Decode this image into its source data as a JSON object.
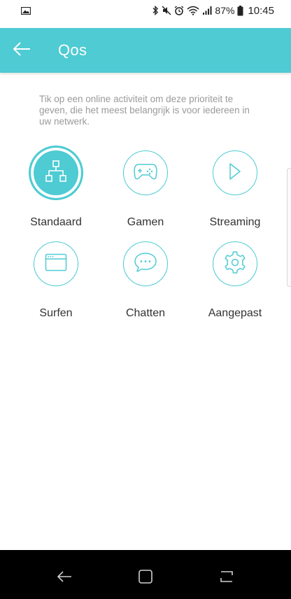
{
  "status_bar": {
    "battery": "87%",
    "time": "10:45"
  },
  "app_bar": {
    "title": "Qos"
  },
  "description": "Tik op een online activiteit om deze prioriteit te geven, die het meest belangrijk is voor iedereen in uw netwerk.",
  "modes": [
    {
      "label": "Standaard",
      "icon": "network-icon",
      "selected": true
    },
    {
      "label": "Gamen",
      "icon": "gamepad-icon",
      "selected": false
    },
    {
      "label": "Streaming",
      "icon": "play-icon",
      "selected": false
    },
    {
      "label": "Surfen",
      "icon": "browser-icon",
      "selected": false
    },
    {
      "label": "Chatten",
      "icon": "chat-icon",
      "selected": false
    },
    {
      "label": "Aangepast",
      "icon": "gear-icon",
      "selected": false
    }
  ],
  "colors": {
    "accent": "#4ecbd3",
    "nav_bar": "#000000"
  }
}
